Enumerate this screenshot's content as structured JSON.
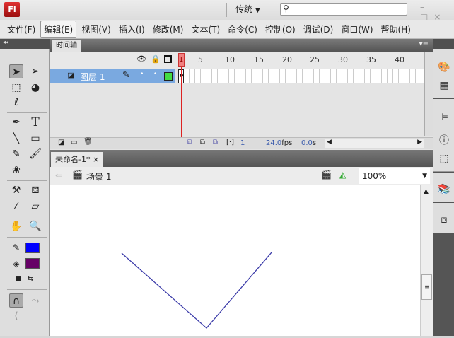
{
  "app": {
    "logo": "Fl",
    "workspace": "传统",
    "workspace_arrow": "▼",
    "search_placeholder": "",
    "window_controls": "–□×"
  },
  "menu": [
    "文件(F)",
    "编辑(E)",
    "视图(V)",
    "插入(I)",
    "修改(M)",
    "文本(T)",
    "命令(C)",
    "控制(O)",
    "调试(D)",
    "窗口(W)",
    "帮助(H)"
  ],
  "timeline": {
    "tab": "时间轴",
    "layer_name": "图层 1",
    "frame_ticks": [
      "1",
      "5",
      "10",
      "15",
      "20",
      "25",
      "30",
      "35",
      "40"
    ],
    "current_frame": "1",
    "fps": "24.0",
    "fps_unit": "fps",
    "time": "0.0",
    "time_unit": "s"
  },
  "document": {
    "tab": "未命名-1*",
    "close": "×",
    "scene": "场景 1",
    "zoom": "100%"
  },
  "colors": {
    "stroke": "#0000ff",
    "fill": "#660066",
    "line": "#3a3aa8"
  }
}
